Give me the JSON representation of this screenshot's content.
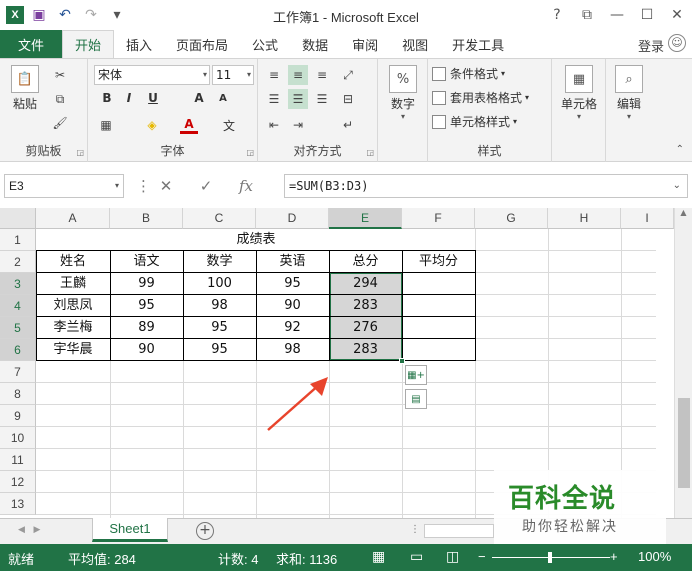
{
  "title": "工作簿1 - Microsoft Excel",
  "titlebar": {
    "help": "?",
    "restore": "⧉",
    "minimize": "—",
    "maximize": "☐",
    "close": "✕"
  },
  "qat": {
    "logo": "X",
    "save": "▣",
    "undo": "↶",
    "redo": "↷",
    "customize": "▾"
  },
  "ribbon_tabs": [
    "文件",
    "开始",
    "插入",
    "页面布局",
    "公式",
    "数据",
    "审阅",
    "视图",
    "开发工具"
  ],
  "login": "登录",
  "clipboard": {
    "paste": "粘贴",
    "label": "剪贴板"
  },
  "font": {
    "name": "宋体",
    "size": "11",
    "label": "字体",
    "bold": "B",
    "italic": "I",
    "underline": "U",
    "grow": "A",
    "shrink": "A",
    "color_letter": "A",
    "phonetic": "文"
  },
  "alignment": {
    "label": "对齐方式"
  },
  "number": {
    "symbol": "%",
    "label": "数字"
  },
  "styles": {
    "conditional": "条件格式",
    "table": "套用表格格式",
    "cell": "单元格样式",
    "label": "样式"
  },
  "cells": {
    "label": "单元格"
  },
  "editing": {
    "label": "编辑"
  },
  "formula_bar": {
    "name_box": "E3",
    "cancel": "✕",
    "enter": "✓",
    "fx": "fx",
    "formula": "=SUM(B3:D3)"
  },
  "columns": [
    "A",
    "B",
    "C",
    "D",
    "E",
    "F",
    "G",
    "H",
    "I"
  ],
  "rows": [
    "1",
    "2",
    "3",
    "4",
    "5",
    "6",
    "7",
    "8",
    "9",
    "10",
    "11",
    "12",
    "13"
  ],
  "sheet": {
    "title": "成绩表",
    "headers": [
      "姓名",
      "语文",
      "数学",
      "英语",
      "总分",
      "平均分"
    ],
    "data": [
      [
        "王麟",
        "99",
        "100",
        "95",
        "294",
        ""
      ],
      [
        "刘思凤",
        "95",
        "98",
        "90",
        "283",
        ""
      ],
      [
        "李兰梅",
        "89",
        "95",
        "92",
        "276",
        ""
      ],
      [
        "宇华晨",
        "90",
        "95",
        "98",
        "283",
        ""
      ]
    ]
  },
  "sheet_tabs": {
    "active": "Sheet1",
    "add": "+"
  },
  "watermark": {
    "main": "百科全说",
    "sub": "助你轻松解决"
  },
  "status": {
    "ready": "就绪",
    "average": "平均值: 284",
    "count": "计数: 4",
    "sum": "求和: 1136",
    "zoom": "100%",
    "minus": "−",
    "plus": "+"
  },
  "colors": {
    "excel_green": "#217346",
    "selection_fill": "#b4b4b4",
    "arrow": "#e8442c"
  }
}
